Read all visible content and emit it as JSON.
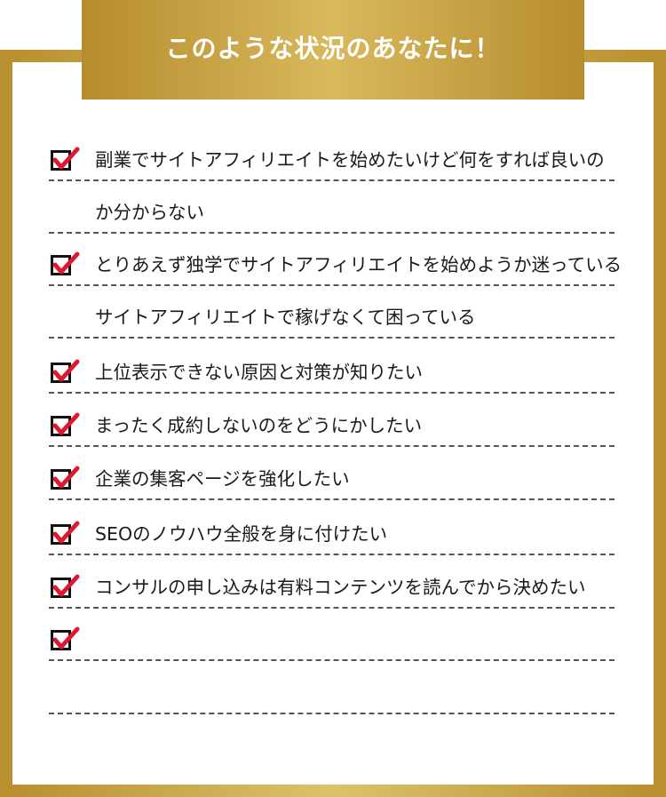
{
  "header": {
    "title": "このような状況のあなたに！"
  },
  "checklist": {
    "items": [
      {
        "text": "副業でサイトアフィリエイトを始めたいけど何をすれば良いの",
        "checked": true
      },
      {
        "text": "か分からない",
        "checked": false
      },
      {
        "text": "とりあえず独学でサイトアフィリエイトを始めようか迷っている",
        "checked": true
      },
      {
        "text": "サイトアフィリエイトで稼げなくて困っている",
        "checked": false
      },
      {
        "text": "上位表示できない原因と対策が知りたい",
        "checked": true
      },
      {
        "text": "まったく成約しないのをどうにかしたい",
        "checked": true
      },
      {
        "text": "企業の集客ページを強化したい",
        "checked": true
      },
      {
        "text": "SEOのノウハウ全般を身に付けたい",
        "checked": true
      },
      {
        "text": "コンサルの申し込みは有料コンテンツを読んでから決めたい",
        "checked": true
      },
      {
        "text": "",
        "checked": true
      },
      {
        "text": "",
        "checked": false
      }
    ]
  },
  "colors": {
    "gold": "#c9a646",
    "check": "#e0182d",
    "line": "#555555"
  },
  "icons": {
    "check": "checkbox-checked-icon"
  }
}
